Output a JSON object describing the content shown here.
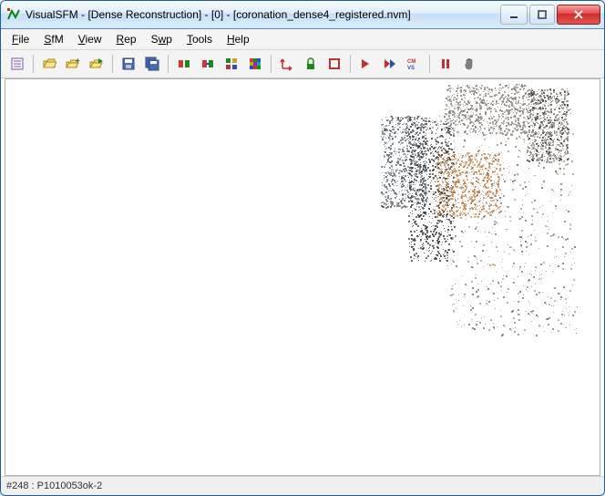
{
  "titlebar": {
    "app": "VisualSFM",
    "mode": "[Dense Reconstruction]",
    "index": "[0]",
    "file": "[coronation_dense4_registered.nvm]"
  },
  "menu": {
    "file": "File",
    "sfm": "SfM",
    "view": "View",
    "rep": "Rep",
    "swp": "Swp",
    "tools": "Tools",
    "help": "Help"
  },
  "toolbar": {
    "new": "new-project-icon",
    "open": "open-images-icon",
    "open_multi": "open-multi-icon",
    "open_plus": "open-add-icon",
    "save": "save-icon",
    "save_all": "save-all-icon",
    "match": "compute-match-icon",
    "match_missing": "compute-missing-match-icon",
    "reconstruct": "reconstruct-sparse-icon",
    "reconstruct_dense": "reconstruct-dense-icon",
    "axis": "axis-icon",
    "lock": "lock-icon",
    "bounding": "bounding-box-icon",
    "next": "next-icon",
    "next_pair": "next-pair-icon",
    "cmvs": "cmvs-icon",
    "pause": "pause-icon",
    "hand": "hand-icon"
  },
  "status": {
    "text": "#248 : P1010053ok-2"
  }
}
